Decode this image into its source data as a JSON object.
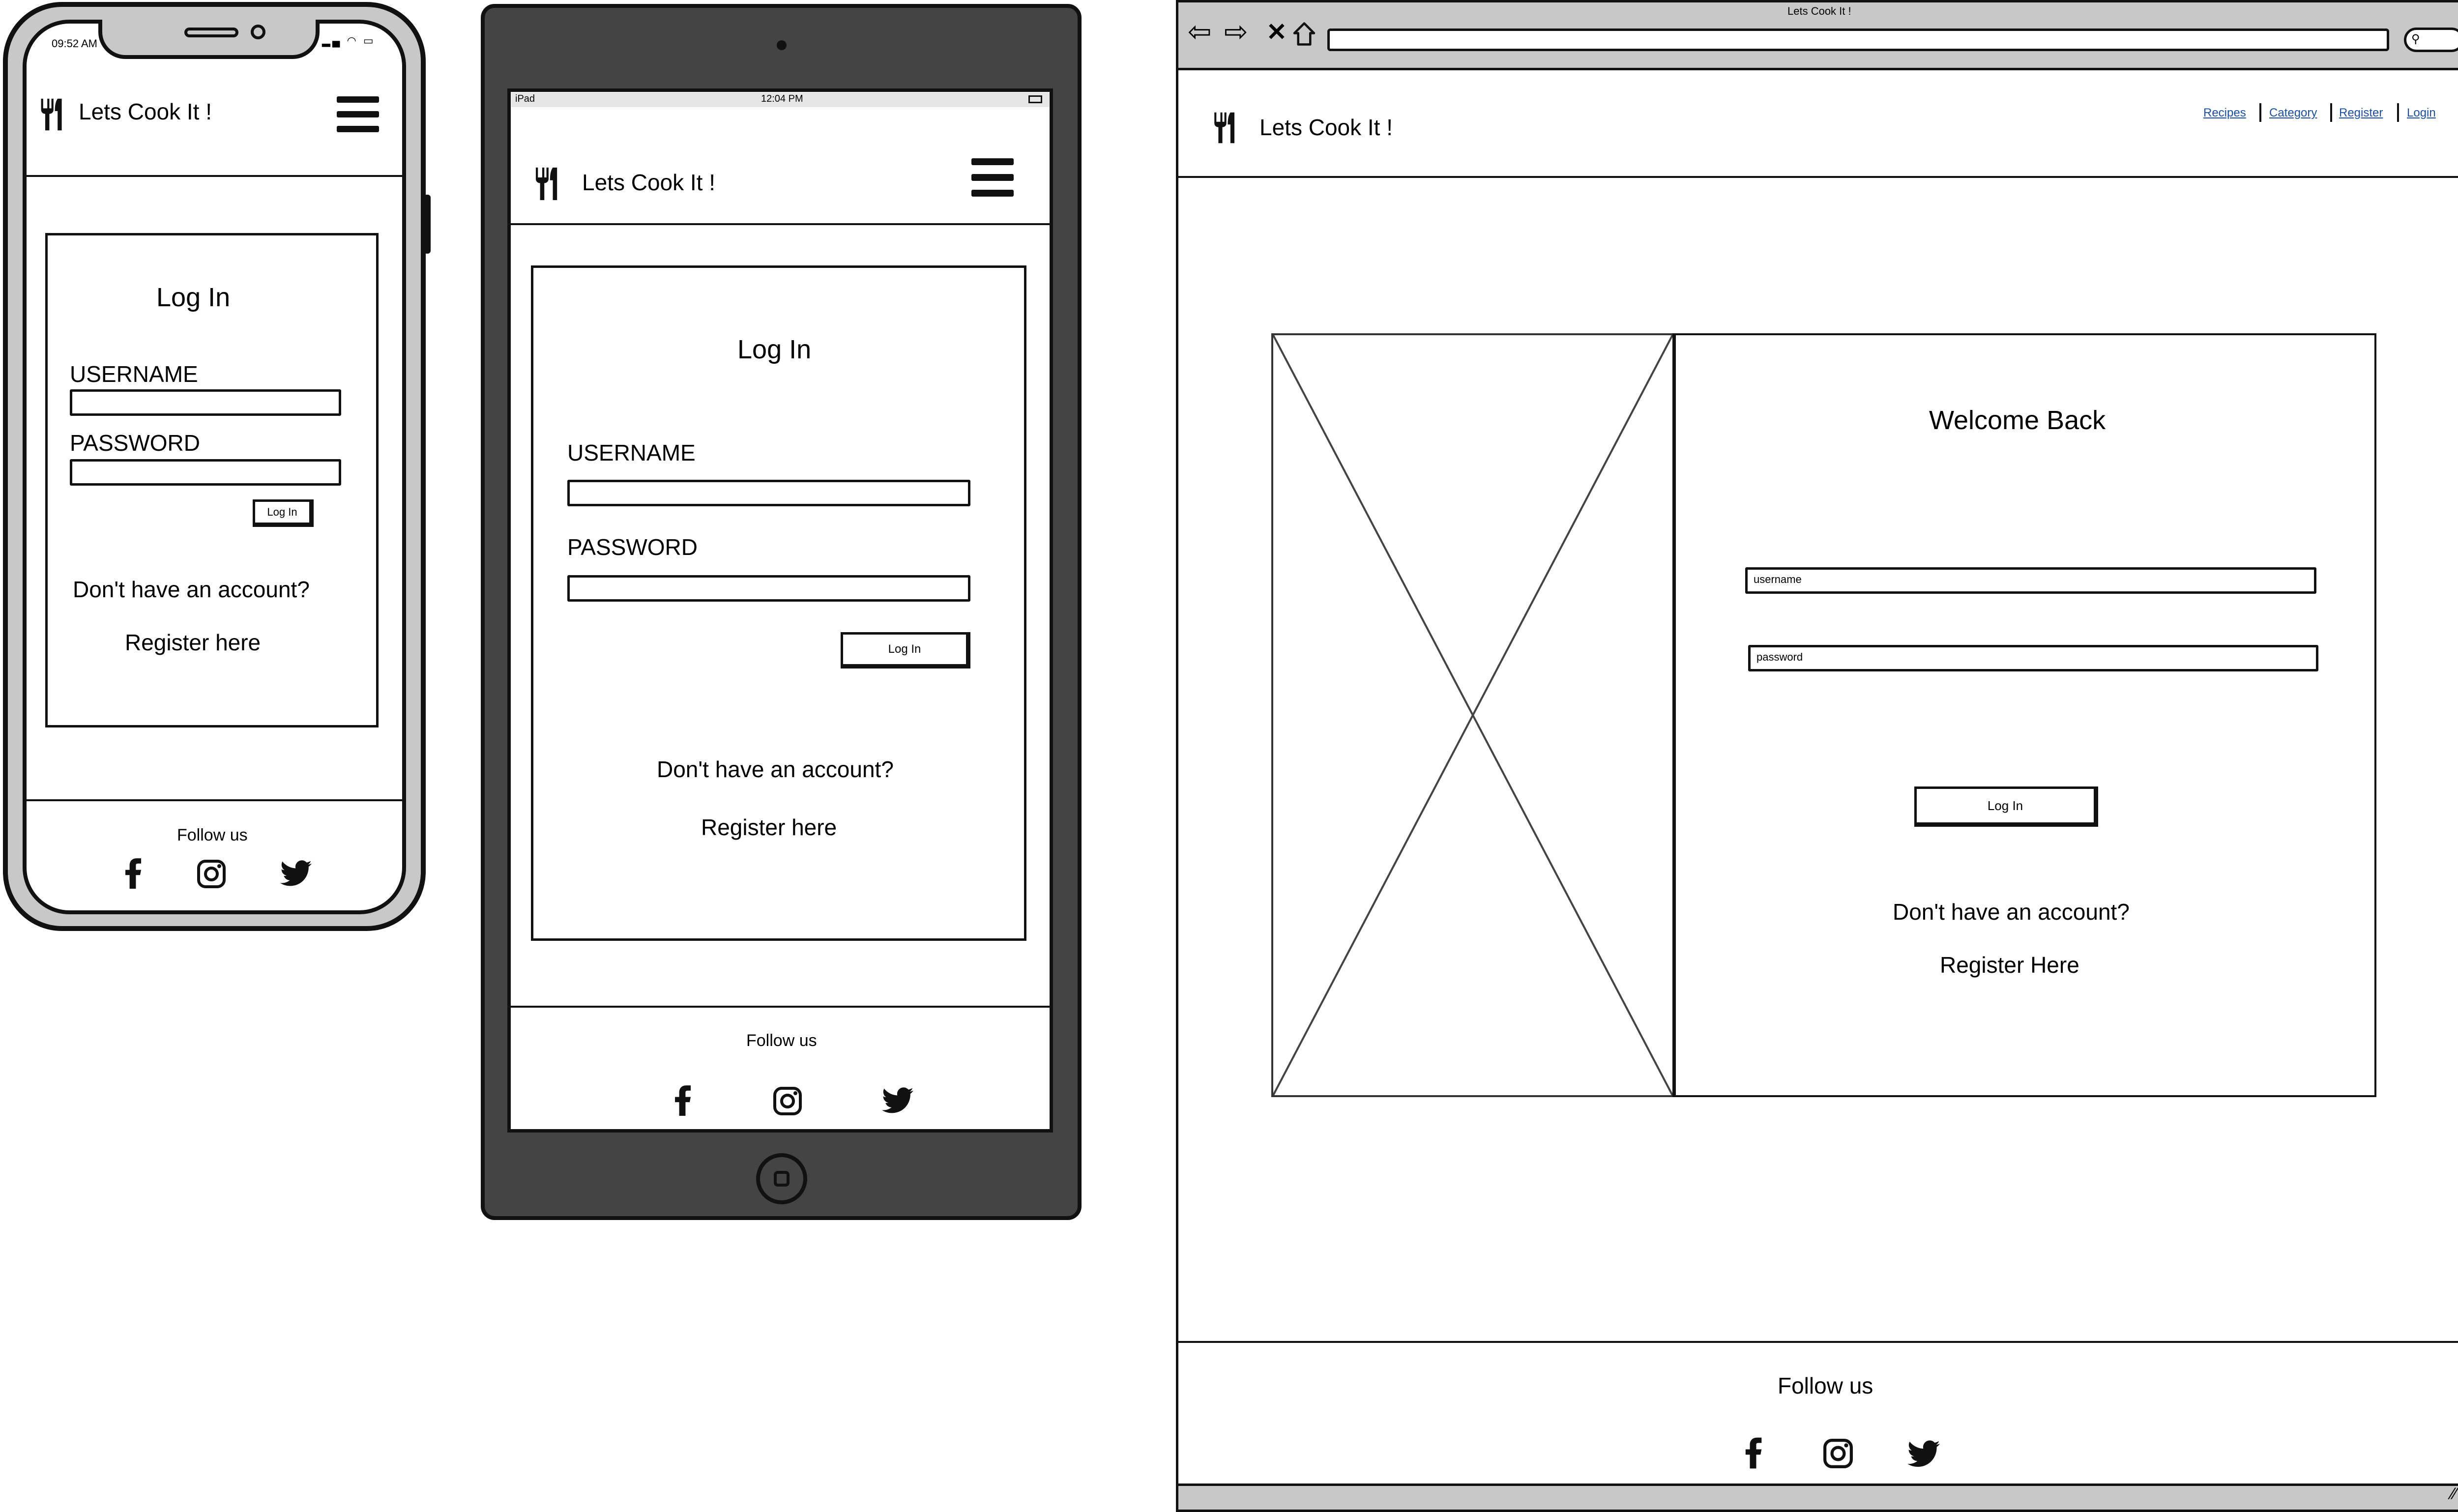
{
  "brand": "Lets Cook It !",
  "phone": {
    "status_time": "09:52 AM",
    "login_title": "Log In",
    "username_label": "USERNAME",
    "password_label": "PASSWORD",
    "login_button": "Log In",
    "no_account": "Don't have an account?",
    "register_link": "Register here",
    "follow_us": "Follow us"
  },
  "tablet": {
    "status_device": "iPad",
    "status_time": "12:04 PM",
    "login_title": "Log In",
    "username_label": "USERNAME",
    "password_label": "PASSWORD",
    "login_button": "Log In",
    "no_account": "Don't have an account?",
    "register_link": "Register here",
    "follow_us": "Follow us"
  },
  "desktop": {
    "window_title": "Lets Cook It !",
    "nav": [
      "Recipes",
      "Category",
      "Register",
      "Login"
    ],
    "welcome_title": "Welcome Back",
    "username_placeholder": "username",
    "password_placeholder": "password",
    "login_button": "Log In",
    "no_account": "Don't have an account?",
    "register_link": "Register Here",
    "follow_us": "Follow us"
  },
  "social_icons": [
    "facebook-icon",
    "instagram-icon",
    "twitter-icon"
  ],
  "colors": {
    "stroke": "#111111",
    "device_dark": "#444444",
    "device_light": "#c8c8c8",
    "link": "#1b4fa8"
  }
}
